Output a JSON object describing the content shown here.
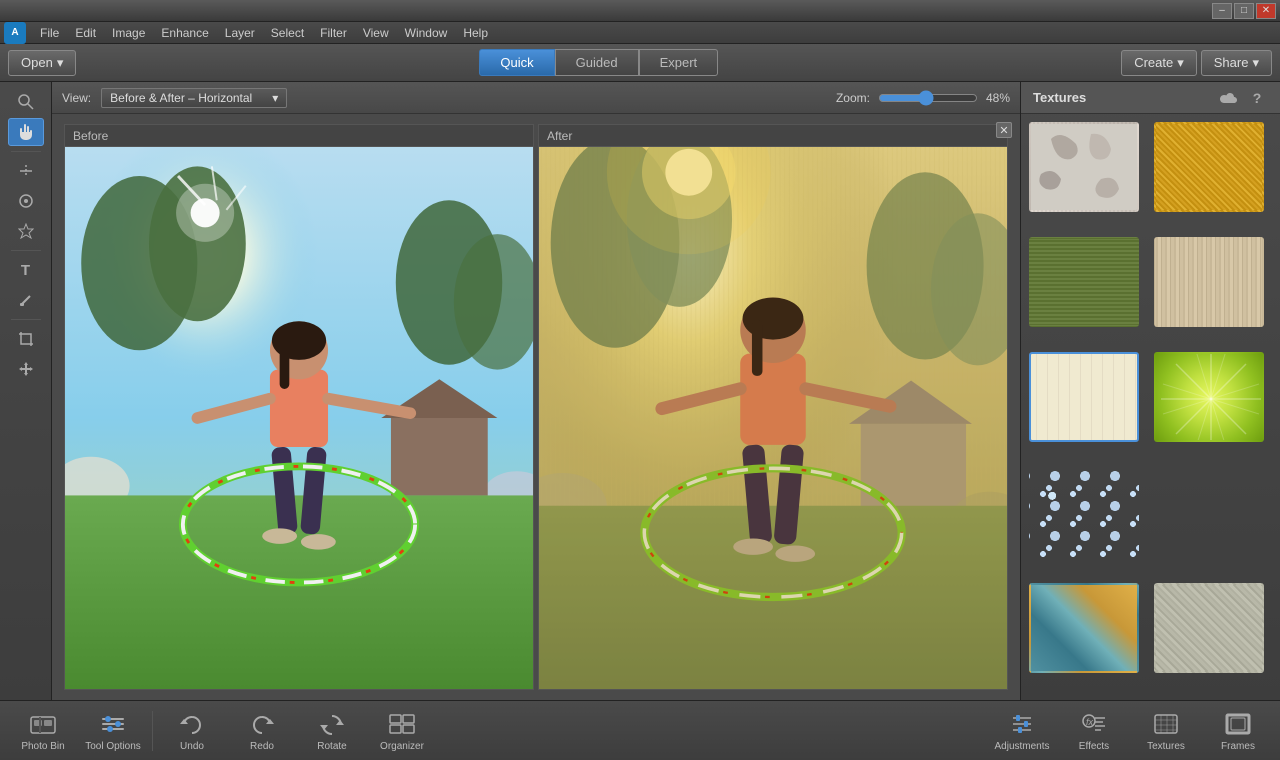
{
  "titlebar": {
    "minimize_label": "–",
    "restore_label": "□",
    "close_label": "✕"
  },
  "menubar": {
    "logo": "A",
    "items": [
      "File",
      "Edit",
      "Image",
      "Enhance",
      "Layer",
      "Select",
      "Filter",
      "View",
      "Window",
      "Help"
    ]
  },
  "toolbar": {
    "open_label": "Open",
    "open_arrow": "▾",
    "tabs": [
      {
        "id": "quick",
        "label": "Quick",
        "active": true
      },
      {
        "id": "guided",
        "label": "Guided",
        "active": false
      },
      {
        "id": "expert",
        "label": "Expert",
        "active": false
      }
    ],
    "create_label": "Create",
    "create_arrow": "▾",
    "share_label": "Share",
    "share_arrow": "▾"
  },
  "viewbar": {
    "view_label": "View:",
    "view_option": "Before & After – Horizontal",
    "zoom_label": "Zoom:",
    "zoom_value": 48,
    "zoom_display": "48%"
  },
  "canvas": {
    "close_btn": "✕",
    "before_label": "Before",
    "after_label": "After"
  },
  "tools": [
    {
      "id": "zoom",
      "icon": "🔍",
      "active": false
    },
    {
      "id": "hand",
      "icon": "✋",
      "active": true
    },
    {
      "id": "straighten",
      "icon": "◇",
      "active": false
    },
    {
      "id": "redeye",
      "icon": "◉",
      "active": false
    },
    {
      "id": "whiten",
      "icon": "✦",
      "active": false
    },
    {
      "id": "text",
      "icon": "T",
      "active": false
    },
    {
      "id": "paint",
      "icon": "✏",
      "active": false
    },
    {
      "id": "crop",
      "icon": "⌗",
      "active": false
    },
    {
      "id": "move",
      "icon": "✣",
      "active": false
    }
  ],
  "right_panel": {
    "title": "Textures",
    "icons": [
      "☁",
      "?"
    ],
    "textures": [
      {
        "id": 1,
        "class": "tex-peeling",
        "selected": false
      },
      {
        "id": 2,
        "class": "tex-fabric-yellow",
        "selected": false
      },
      {
        "id": 3,
        "class": "tex-fabric-green",
        "selected": false
      },
      {
        "id": 4,
        "class": "tex-fabric-beige",
        "selected": false
      },
      {
        "id": 5,
        "class": "tex-lines-cream",
        "selected": true
      },
      {
        "id": 6,
        "class": "tex-starburst",
        "selected": false
      },
      {
        "id": 7,
        "class": "tex-blue-dots",
        "selected": false
      },
      {
        "id": 8,
        "class": "tex-sand",
        "selected": false
      },
      {
        "id": 9,
        "class": "tex-teal",
        "selected": false
      },
      {
        "id": 10,
        "class": "tex-stone",
        "selected": false
      }
    ]
  },
  "bottom": {
    "items": [
      {
        "id": "photo-bin",
        "label": "Photo Bin"
      },
      {
        "id": "tool-options",
        "label": "Tool Options"
      },
      {
        "id": "undo",
        "label": "Undo"
      },
      {
        "id": "redo",
        "label": "Redo"
      },
      {
        "id": "rotate",
        "label": "Rotate"
      },
      {
        "id": "organizer",
        "label": "Organizer"
      }
    ],
    "right_items": [
      {
        "id": "adjustments",
        "label": "Adjustments"
      },
      {
        "id": "effects",
        "label": "Effects"
      },
      {
        "id": "textures",
        "label": "Textures"
      },
      {
        "id": "frames",
        "label": "Frames"
      }
    ]
  }
}
